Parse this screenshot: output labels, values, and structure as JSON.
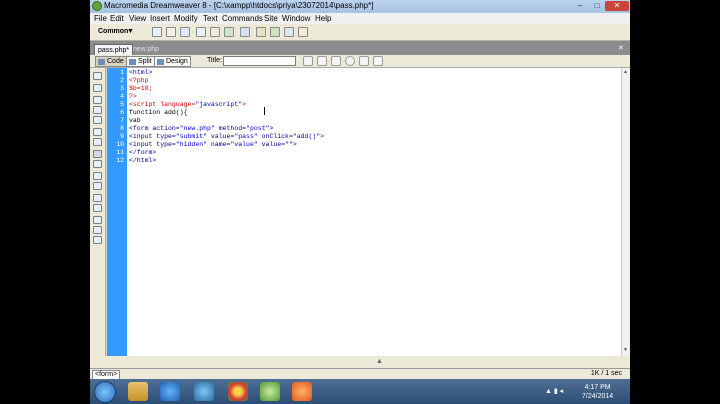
{
  "window": {
    "title": "Macromedia Dreamweaver 8 - [C:\\xampp\\htdocs\\priya\\23072014\\pass.php*]",
    "min_label": "–",
    "max_label": "□",
    "close_label": "✕"
  },
  "menu": [
    "File",
    "Edit",
    "View",
    "Insert",
    "Modify",
    "Text",
    "Commands",
    "Site",
    "Window",
    "Help"
  ],
  "insert_bar": {
    "category": "Common",
    "caret": "▼"
  },
  "doc_tabs": {
    "tabs": [
      "pass.php*",
      "new.php"
    ],
    "close_label": "✕"
  },
  "doc_toolbar": {
    "code_label": "Code",
    "split_label": "Split",
    "design_label": "Design",
    "title_label": "Title:",
    "title_value": ""
  },
  "code": {
    "line_numbers": [
      "1",
      "2",
      "3",
      "4",
      "5",
      "6",
      "7",
      "8",
      "9",
      "10",
      "11",
      "12"
    ],
    "lines": [
      [
        {
          "t": "<html>",
          "c": "tag"
        }
      ],
      [
        {
          "t": "<?php",
          "c": "php"
        }
      ],
      [
        {
          "t": "$b=10;",
          "c": "php"
        }
      ],
      [
        {
          "t": "?>",
          "c": "php"
        }
      ],
      [
        {
          "t": "<script language=",
          "c": "php"
        },
        {
          "t": "\"javascript\"",
          "c": "str"
        },
        {
          "t": ">",
          "c": "php"
        }
      ],
      [
        {
          "t": "function add(){",
          "c": "plain"
        }
      ],
      [
        {
          "t": "vab",
          "c": "plain"
        }
      ],
      [
        {
          "t": "<form action=",
          "c": "tag"
        },
        {
          "t": "\"new.php\"",
          "c": "str"
        },
        {
          "t": " method=",
          "c": "tag"
        },
        {
          "t": "\"post\"",
          "c": "str"
        },
        {
          "t": ">",
          "c": "tag"
        }
      ],
      [
        {
          "t": "<input type=",
          "c": "tag"
        },
        {
          "t": "\"submit\"",
          "c": "str"
        },
        {
          "t": " value=",
          "c": "tag"
        },
        {
          "t": "\"pass\"",
          "c": "str"
        },
        {
          "t": " onClick=",
          "c": "tag"
        },
        {
          "t": "\"add()\"",
          "c": "str"
        },
        {
          "t": ">",
          "c": "tag"
        }
      ],
      [
        {
          "t": "<input type=",
          "c": "tag"
        },
        {
          "t": "\"hidden\"",
          "c": "str"
        },
        {
          "t": " name=",
          "c": "tag"
        },
        {
          "t": "\"value\"",
          "c": "str"
        },
        {
          "t": " value=",
          "c": "tag"
        },
        {
          "t": "\"\"",
          "c": "str"
        },
        {
          "t": ">",
          "c": "tag"
        }
      ],
      [
        {
          "t": "</form>",
          "c": "tag"
        }
      ],
      [
        {
          "t": "</html>",
          "c": "tag"
        }
      ]
    ]
  },
  "status": {
    "tag_selector": "<form>",
    "size": "1K / 1 sec"
  },
  "taskbar": {
    "time": "4:17 PM",
    "date": "7/24/2014"
  }
}
